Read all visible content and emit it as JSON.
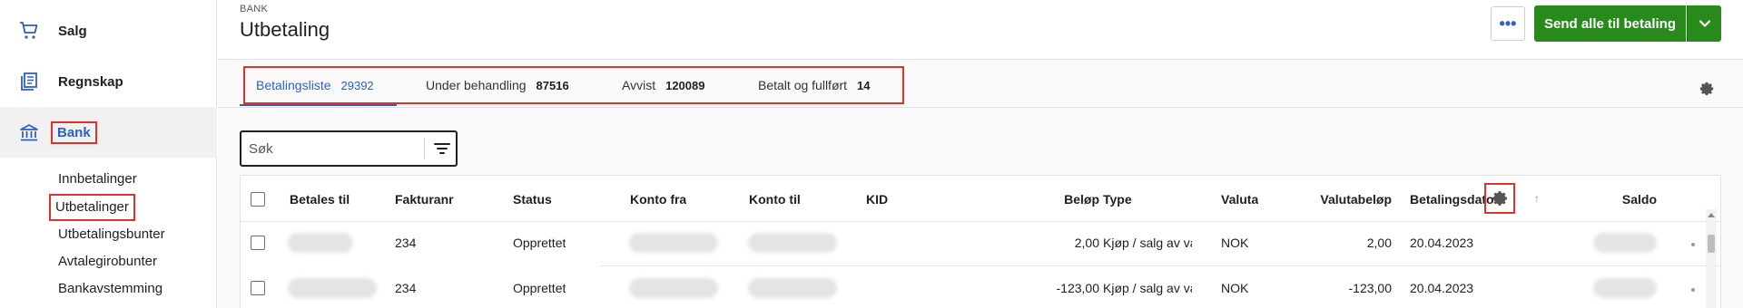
{
  "sidebar": {
    "items": [
      {
        "label": "Salg",
        "icon": "cart-icon"
      },
      {
        "label": "Regnskap",
        "icon": "ledger-icon"
      },
      {
        "label": "Bank",
        "icon": "bank-icon"
      }
    ],
    "subitems": [
      "Innbetalinger",
      "Utbetalinger",
      "Utbetalingsbunter",
      "Avtalegirobunter",
      "Bankavstemming"
    ]
  },
  "header": {
    "breadcrumb": "BANK",
    "title": "Utbetaling",
    "more_label": "•••",
    "send_label": "Send alle til betaling"
  },
  "tabs": [
    {
      "label": "Betalingsliste",
      "count": "29392"
    },
    {
      "label": "Under behandling",
      "count": "87516"
    },
    {
      "label": "Avvist",
      "count": "120089"
    },
    {
      "label": "Betalt og fullført",
      "count": "14"
    }
  ],
  "search": {
    "placeholder": "Søk"
  },
  "table": {
    "headers": [
      "Betales til",
      "Fakturanr",
      "Status",
      "Konto fra",
      "Konto til",
      "KID",
      "Beløp",
      "Type",
      "Valuta",
      "Valutabeløp",
      "Betalingsdato",
      "Saldo"
    ],
    "sort_indicator": "↑",
    "rows": [
      {
        "fakturanr": "234",
        "status": "Opprettet",
        "belop": "2,00",
        "type": "Kjøp / salg av va",
        "valuta": "NOK",
        "valutabelop": "2,00",
        "betalingsdato": "20.04.2023"
      },
      {
        "fakturanr": "234",
        "status": "Opprettet",
        "belop": "-123,00",
        "type": "Kjøp / salg av va",
        "valuta": "NOK",
        "valutabelop": "-123,00",
        "betalingsdato": "20.04.2023"
      }
    ]
  },
  "colors": {
    "accent": "#2f5fc4",
    "primary_button": "#288a1a",
    "highlight_outline": "#e0322d"
  }
}
